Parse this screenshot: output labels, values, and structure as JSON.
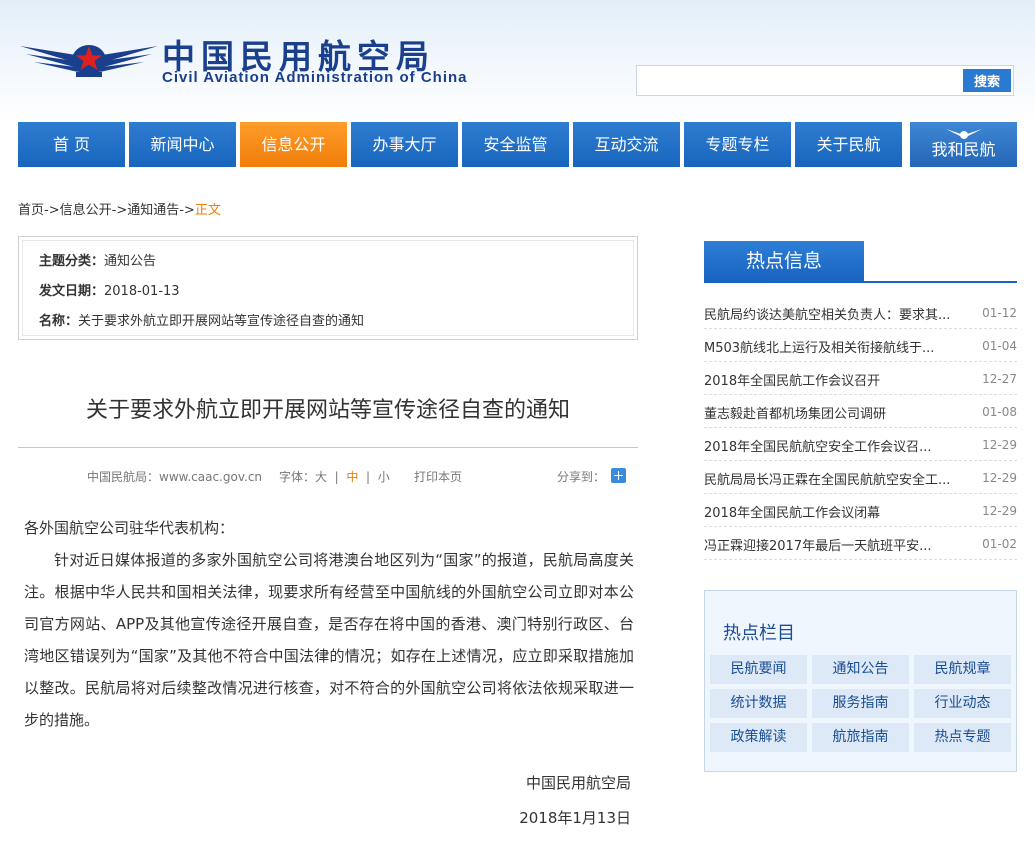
{
  "header": {
    "title_cn": "中国民用航空局",
    "title_en": "Civil Aviation Administration of China",
    "search": {
      "placeholder": "",
      "value": "",
      "button_label": "搜索"
    }
  },
  "nav": {
    "items": [
      {
        "label": "首 页",
        "active": false
      },
      {
        "label": "新闻中心",
        "active": false
      },
      {
        "label": "信息公开",
        "active": true
      },
      {
        "label": "办事大厅",
        "active": false
      },
      {
        "label": "安全监管",
        "active": false
      },
      {
        "label": "互动交流",
        "active": false
      },
      {
        "label": "专题专栏",
        "active": false
      },
      {
        "label": "关于民航",
        "active": false
      },
      {
        "label": "我和民航",
        "active": false
      }
    ]
  },
  "breadcrumb": {
    "items": [
      "首页",
      "信息公开",
      "通知通告"
    ],
    "separator": "->",
    "current": "正文"
  },
  "meta": {
    "category_label": "主题分类：",
    "category": "通知公告",
    "date_label": "发文日期：",
    "date": "2018-01-13",
    "name_label": "名称：",
    "name": "关于要求外航立即开展网站等宣传途径自查的通知"
  },
  "article": {
    "title": "关于要求外航立即开展网站等宣传途径自查的通知",
    "source": "中国民航局：www.caac.gov.cn",
    "font_label": "字体：",
    "font_sizes": [
      "大",
      "中",
      "小"
    ],
    "print_label": "打印本页",
    "share_label": "分享到：",
    "salutation": "各外国航空公司驻华代表机构：",
    "paragraphs": [
      "针对近日媒体报道的多家外国航空公司将港澳台地区列为“国家”的报道，民航局高度关注。根据中华人民共和国相关法律，现要求所有经营至中国航线的外国航空公司立即对本公司官方网站、APP及其他宣传途径开展自查，是否存在将中国的香港、澳门特别行政区、台湾地区错误列为“国家”及其他不符合中国法律的情况；如存在上述情况，应立即采取措施加以整改。民航局将对后续整改情况进行核查，对不符合的外国航空公司将依法依规采取进一步的措施。"
    ],
    "signature": "中国民用航空局",
    "sign_date": "2018年1月13日"
  },
  "hot": {
    "title": "热点信息",
    "items": [
      {
        "title": "民航局约谈达美航空相关负责人：要求其...",
        "date": "01-12"
      },
      {
        "title": "M503航线北上运行及相关衔接航线于...",
        "date": "01-04"
      },
      {
        "title": "2018年全国民航工作会议召开",
        "date": "12-27"
      },
      {
        "title": "董志毅赴首都机场集团公司调研",
        "date": "01-08"
      },
      {
        "title": "2018年全国民航航空安全工作会议召...",
        "date": "12-29"
      },
      {
        "title": "民航局局长冯正霖在全国民航航空安全工...",
        "date": "12-29"
      },
      {
        "title": "2018年全国民航工作会议闭幕",
        "date": "12-29"
      },
      {
        "title": "冯正霖迎接2017年最后一天航班平安...",
        "date": "01-02"
      }
    ]
  },
  "columns": {
    "title": "热点栏目",
    "items": [
      "民航要闻",
      "通知公告",
      "民航规章",
      "统计数据",
      "服务指南",
      "行业动态",
      "政策解读",
      "航旅指南",
      "热点专题"
    ]
  },
  "colors": {
    "brand_blue": "#1a3f8c",
    "nav_blue": "#1865bd",
    "nav_active": "#f07d09",
    "link_orange": "#f07d09"
  }
}
